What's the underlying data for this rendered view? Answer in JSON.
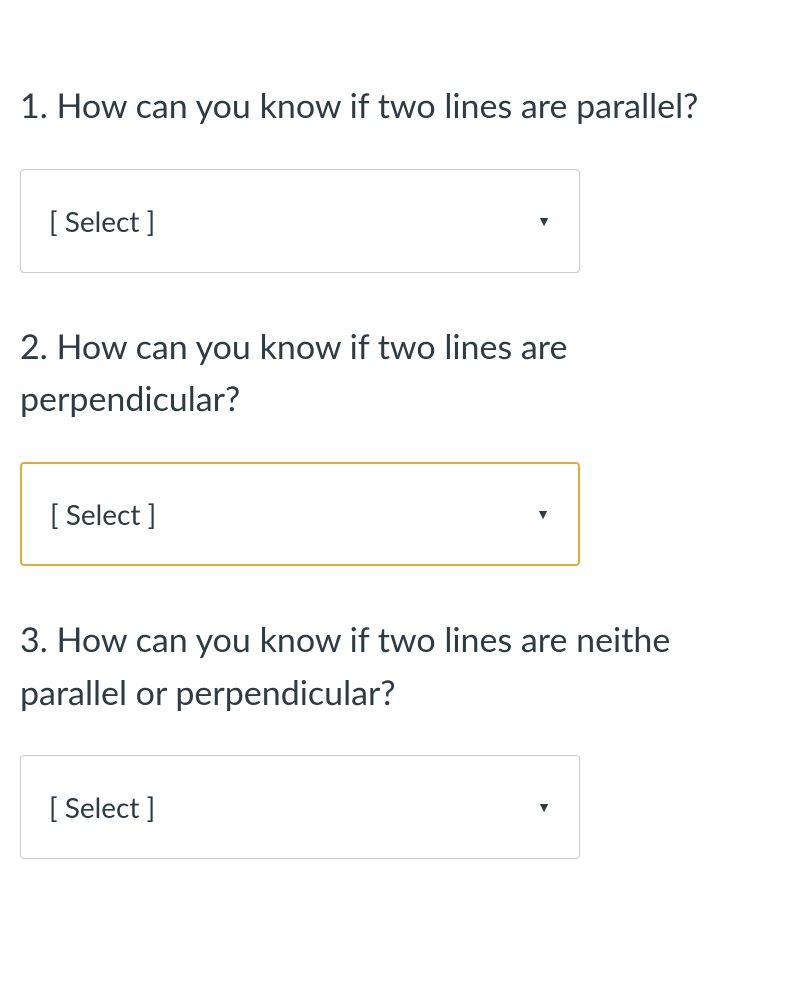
{
  "questions": [
    {
      "number": "1.",
      "text": "How can you know if two lines are parallel?",
      "select_placeholder": "[ Select ]",
      "active": false
    },
    {
      "number": "2.",
      "text": "How can you know if two lines are perpendicular?",
      "select_placeholder": "[ Select ]",
      "active": true
    },
    {
      "number": "3.",
      "text": "How can you know if two lines are neithe parallel or perpendicular?",
      "select_placeholder": "[ Select ]",
      "active": false
    }
  ]
}
